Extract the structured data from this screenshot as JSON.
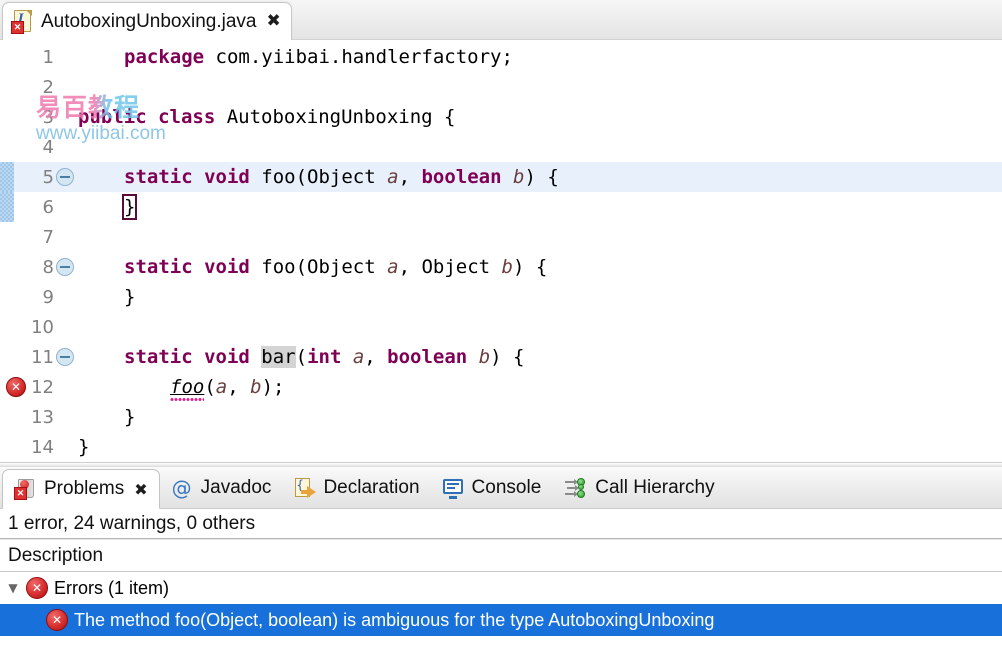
{
  "editor_tab": {
    "title": "AutoboxingUnboxing.java",
    "file_icon": "java-file-icon",
    "error_badge_icon": "error-badge-icon",
    "close_label": "✖"
  },
  "watermark": {
    "cn": "易百教程",
    "url": "www.yiibai.com"
  },
  "code": {
    "lines": [
      {
        "num": "1",
        "fold": false,
        "marker": "none",
        "change": false,
        "current": false,
        "tokens": [
          {
            "t": "package ",
            "c": "kw"
          },
          {
            "t": "com.yiibai.handlerfactory;",
            "c": "pl"
          }
        ],
        "indent": 0,
        "clipped": true
      },
      {
        "num": "2",
        "fold": false,
        "marker": "none",
        "change": false,
        "current": false,
        "tokens": [],
        "indent": 0
      },
      {
        "num": "3",
        "fold": false,
        "marker": "none",
        "change": false,
        "current": false,
        "tokens": [
          {
            "t": "public class ",
            "c": "kw"
          },
          {
            "t": "AutoboxingUnboxing {",
            "c": "pl"
          }
        ],
        "indent": 0
      },
      {
        "num": "4",
        "fold": false,
        "marker": "none",
        "change": false,
        "current": false,
        "tokens": [],
        "indent": 0
      },
      {
        "num": "5",
        "fold": true,
        "marker": "none",
        "change": true,
        "current": true,
        "tokens": [
          {
            "t": "static void ",
            "c": "kw"
          },
          {
            "t": "foo(Object ",
            "c": "pl"
          },
          {
            "t": "a",
            "c": "par"
          },
          {
            "t": ", ",
            "c": "pl"
          },
          {
            "t": "boolean ",
            "c": "kw"
          },
          {
            "t": "b",
            "c": "par"
          },
          {
            "t": ") {",
            "c": "pl"
          }
        ],
        "indent": 1
      },
      {
        "num": "6",
        "fold": false,
        "marker": "none",
        "change": true,
        "current": false,
        "tokens": [
          {
            "t": "}",
            "c": "bracket"
          }
        ],
        "indent": 1
      },
      {
        "num": "7",
        "fold": false,
        "marker": "none",
        "change": false,
        "current": false,
        "tokens": [],
        "indent": 0
      },
      {
        "num": "8",
        "fold": true,
        "marker": "none",
        "change": false,
        "current": false,
        "tokens": [
          {
            "t": "static void ",
            "c": "kw"
          },
          {
            "t": "foo(Object ",
            "c": "pl"
          },
          {
            "t": "a",
            "c": "par"
          },
          {
            "t": ", Object ",
            "c": "pl"
          },
          {
            "t": "b",
            "c": "par"
          },
          {
            "t": ") {",
            "c": "pl"
          }
        ],
        "indent": 1
      },
      {
        "num": "9",
        "fold": false,
        "marker": "none",
        "change": false,
        "current": false,
        "tokens": [
          {
            "t": "}",
            "c": "pl"
          }
        ],
        "indent": 1
      },
      {
        "num": "10",
        "fold": false,
        "marker": "none",
        "change": false,
        "current": false,
        "tokens": [],
        "indent": 0
      },
      {
        "num": "11",
        "fold": true,
        "marker": "none",
        "change": false,
        "current": false,
        "tokens": [
          {
            "t": "static void ",
            "c": "kw"
          },
          {
            "t": "bar",
            "c": "occ"
          },
          {
            "t": "(",
            "c": "pl"
          },
          {
            "t": "int ",
            "c": "kw"
          },
          {
            "t": "a",
            "c": "par"
          },
          {
            "t": ", ",
            "c": "pl"
          },
          {
            "t": "boolean ",
            "c": "kw"
          },
          {
            "t": "b",
            "c": "par"
          },
          {
            "t": ") {",
            "c": "pl"
          }
        ],
        "indent": 1
      },
      {
        "num": "12",
        "fold": false,
        "marker": "error",
        "change": false,
        "current": false,
        "tokens": [
          {
            "t": "foo",
            "c": "mth-err"
          },
          {
            "t": "(",
            "c": "pl"
          },
          {
            "t": "a",
            "c": "par"
          },
          {
            "t": ", ",
            "c": "pl"
          },
          {
            "t": "b",
            "c": "par"
          },
          {
            "t": ");",
            "c": "pl"
          }
        ],
        "indent": 2
      },
      {
        "num": "13",
        "fold": false,
        "marker": "none",
        "change": false,
        "current": false,
        "tokens": [
          {
            "t": "}",
            "c": "pl"
          }
        ],
        "indent": 1
      },
      {
        "num": "14",
        "fold": false,
        "marker": "none",
        "change": false,
        "current": false,
        "tokens": [
          {
            "t": "}",
            "c": "pl"
          }
        ],
        "indent": 0
      }
    ]
  },
  "bottom_view": {
    "tabs": [
      {
        "label": "Problems",
        "icon": "problems-icon",
        "active": true,
        "closable": true
      },
      {
        "label": "Javadoc",
        "icon": "javadoc-at-icon",
        "active": false,
        "closable": false
      },
      {
        "label": "Declaration",
        "icon": "declaration-icon",
        "active": false,
        "closable": false
      },
      {
        "label": "Console",
        "icon": "console-icon",
        "active": false,
        "closable": false
      },
      {
        "label": "Call Hierarchy",
        "icon": "call-hierarchy-icon",
        "active": false,
        "closable": false
      }
    ],
    "summary": "1 error, 24 warnings, 0 others",
    "column_header": "Description",
    "tree": {
      "group": {
        "twisty": "▼",
        "label": "Errors (1 item)",
        "icon": "error-icon"
      },
      "items": [
        {
          "label": "The method foo(Object, boolean) is ambiguous for the type AutoboxingUnboxing",
          "icon": "error-icon",
          "selected": true
        }
      ]
    }
  },
  "colors": {
    "keyword": "#7f0055",
    "parameter": "#6a3e3e",
    "plain": "#000000",
    "error_red": "#d52b2b",
    "selection_blue": "#1871da",
    "current_line": "#e7f0fb",
    "squiggle": "#e8198b"
  }
}
